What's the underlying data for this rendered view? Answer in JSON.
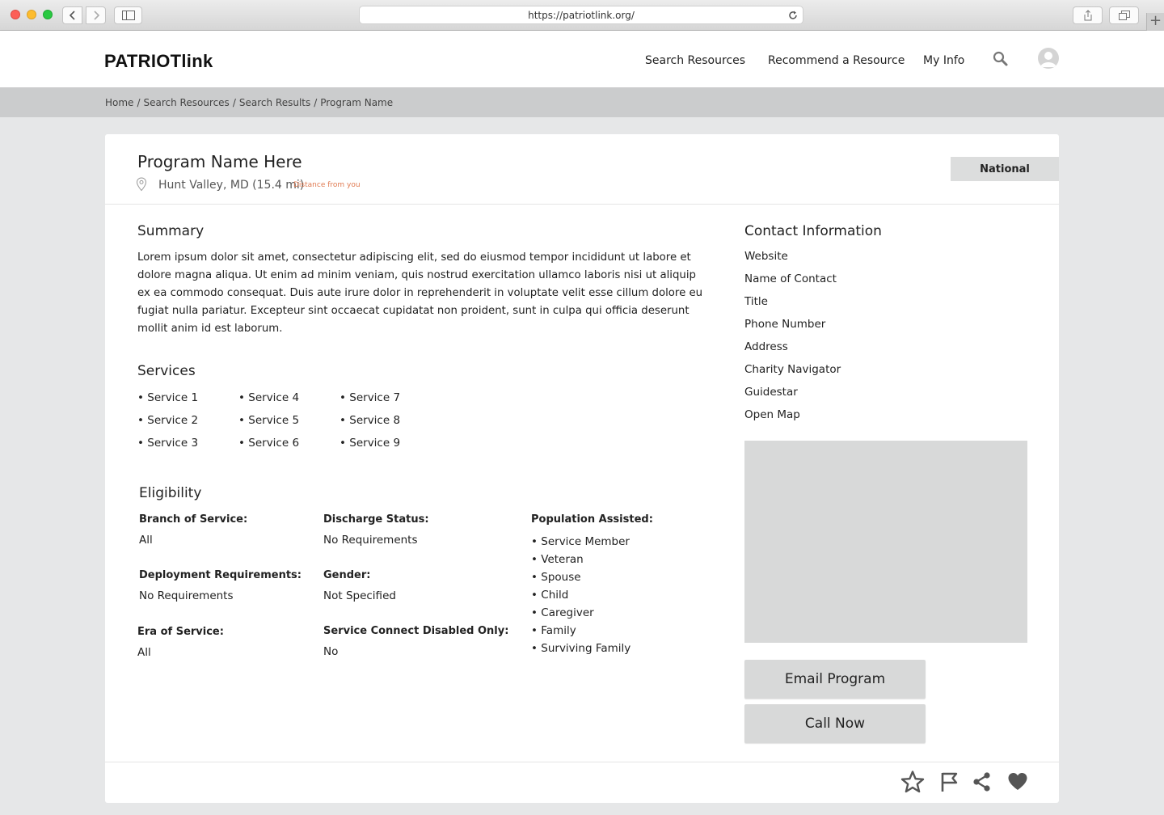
{
  "browser": {
    "url": "https://patriotlink.org/",
    "new_tab": "+"
  },
  "header": {
    "logo": "PATRIOTlink",
    "nav": [
      {
        "label": "Search Resources"
      },
      {
        "label": "Recommend a Resource"
      },
      {
        "label": "My Info"
      }
    ]
  },
  "breadcrumb": [
    "Home",
    "Search Resources",
    "Search Results",
    "Program Name"
  ],
  "breadcrumb_separator": "/",
  "program": {
    "title": "Program Name Here",
    "location": "Hunt Valley, MD (15.4 mi)",
    "distance_note": "Distance from you",
    "badge": "National"
  },
  "summary": {
    "heading": "Summary",
    "text": "Lorem ipsum dolor sit amet, consectetur adipiscing elit, sed do eiusmod tempor incididunt ut labore et dolore magna aliqua. Ut enim ad minim veniam, quis nostrud exercitation ullamco laboris nisi ut aliquip ex ea commodo consequat. Duis aute irure dolor in reprehenderit in voluptate velit esse cillum dolore eu fugiat nulla pariatur. Excepteur sint occaecat cupidatat non proident, sunt in culpa qui officia deserunt mollit anim id est laborum."
  },
  "services": {
    "heading": "Services",
    "bullet": "•",
    "items": [
      "Service 1",
      "Service 2",
      "Service 3",
      "Service 4",
      "Service 5",
      "Service 6",
      "Service 7",
      "Service 8",
      "Service 9"
    ]
  },
  "eligibility": {
    "heading": "Eligibility",
    "branch_label": "Branch of Service:",
    "branch_value": "All",
    "deployment_label": "Deployment Requirements:",
    "deployment_value": "No Requirements",
    "era_label": "Era of Service:",
    "era_value": "All",
    "discharge_label": "Discharge Status:",
    "discharge_value": "No Requirements",
    "gender_label": "Gender:",
    "gender_value": "Not Specified",
    "connect_label": "Service Connect Disabled Only:",
    "connect_value": "No",
    "population_label": "Population Assisted:",
    "population": [
      "Service Member",
      "Veteran",
      "Spouse",
      "Child",
      "Caregiver",
      "Family",
      "Surviving Family"
    ]
  },
  "contact": {
    "heading": "Contact Information",
    "items": [
      "Website",
      "Name of Contact",
      "Title",
      "Phone Number",
      "Address",
      "Charity Navigator",
      "Guidestar",
      "Open Map"
    ]
  },
  "actions": {
    "email": "Email Program",
    "call": "Call Now"
  },
  "footer_icons": [
    "star-icon",
    "flag-icon",
    "share-icon",
    "heart-icon"
  ]
}
